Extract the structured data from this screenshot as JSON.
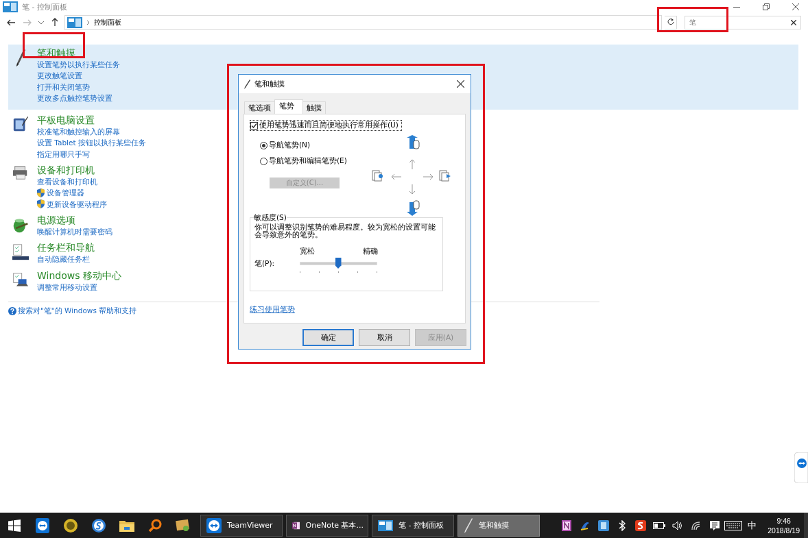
{
  "window": {
    "title": "笔 - 控制面板"
  },
  "address": {
    "path": "控制面板"
  },
  "search": {
    "value": "笔"
  },
  "categories": [
    {
      "kind": "pen",
      "title": "笔和触摸",
      "selected": true,
      "links": [
        {
          "text": "设置笔势以执行某些任务",
          "shield": false
        },
        {
          "text": "更改触笔设置",
          "shield": false
        },
        {
          "text": "打开和关闭笔势",
          "shield": false
        },
        {
          "text": "更改多点触控笔势设置",
          "shield": false
        }
      ]
    },
    {
      "kind": "tablet",
      "title": "平板电脑设置",
      "selected": false,
      "links": [
        {
          "text": "校准笔和触控输入的屏幕",
          "shield": false
        },
        {
          "text": "设置 Tablet 按钮以执行某些任务",
          "shield": false
        },
        {
          "text": "指定用哪只手写",
          "shield": false
        }
      ]
    },
    {
      "kind": "printer",
      "title": "设备和打印机",
      "selected": false,
      "links": [
        {
          "text": "查看设备和打印机",
          "shield": false
        },
        {
          "text": "设备管理器",
          "shield": true
        },
        {
          "text": "更新设备驱动程序",
          "shield": true
        }
      ]
    },
    {
      "kind": "power",
      "title": "电源选项",
      "selected": false,
      "links": [
        {
          "text": "唤醒计算机时需要密码",
          "shield": false
        }
      ]
    },
    {
      "kind": "taskbar",
      "title": "任务栏和导航",
      "selected": false,
      "links": [
        {
          "text": "自动隐藏任务栏",
          "shield": false
        }
      ]
    },
    {
      "kind": "mobility",
      "title": "Windows 移动中心",
      "selected": false,
      "links": [
        {
          "text": "调整常用移动设置",
          "shield": false
        }
      ]
    }
  ],
  "help_link": "搜索对\"笔\"的 Windows 帮助和支持",
  "dialog": {
    "title": "笔和触摸",
    "tabs": [
      {
        "label": "笔选项",
        "selected": false
      },
      {
        "label": "笔势",
        "selected": true
      },
      {
        "label": "触摸",
        "selected": false
      }
    ],
    "enable_checkbox": {
      "label": "使用笔势迅速而且简便地执行常用操作(U)",
      "checked": true
    },
    "radios": [
      {
        "label": "导航笔势(N)",
        "selected": true
      },
      {
        "label": "导航笔势和编辑笔势(E)",
        "selected": false
      }
    ],
    "customize_button": {
      "label": "自定义(C)...",
      "disabled": true
    },
    "sensitivity": {
      "legend": "敏感度(S)",
      "description": "你可以调整识别笔势的难易程度。较为宽松的设置可能会导致意外的笔势。",
      "slider_label": "笔(P):",
      "min_label": "宽松",
      "max_label": "精确",
      "level": 0.5
    },
    "practice_link": "练习使用笔势",
    "buttons": [
      {
        "label": "确定",
        "default": true,
        "disabled": false
      },
      {
        "label": "取消",
        "default": false,
        "disabled": false
      },
      {
        "label": "应用(A)",
        "default": false,
        "disabled": true
      }
    ]
  },
  "taskbar": {
    "tasks": [
      {
        "kind": "teamviewer",
        "label": "TeamViewer",
        "selected": false
      },
      {
        "kind": "onenote",
        "label": "OneNote 基本...",
        "selected": false
      },
      {
        "kind": "panel",
        "label": "笔 - 控制面板",
        "selected": false
      },
      {
        "kind": "pen",
        "label": "笔和触摸",
        "selected": true
      }
    ],
    "ime": "中",
    "time": "9:46",
    "date": "2018/8/19"
  }
}
